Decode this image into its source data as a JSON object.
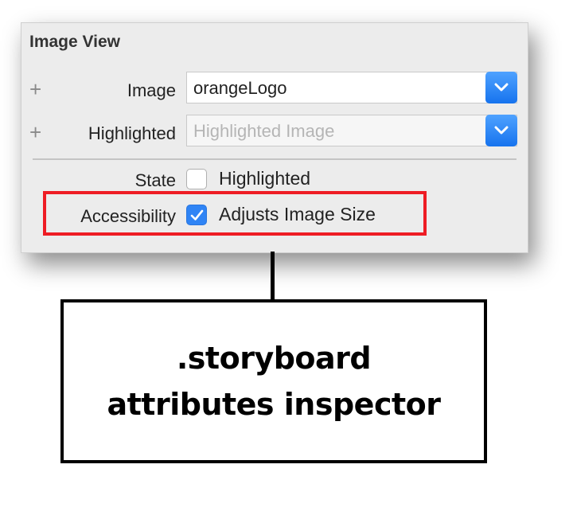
{
  "panel": {
    "title": "Image View",
    "image_row": {
      "plus": "+",
      "label": "Image",
      "value": "orangeLogo"
    },
    "highlighted_row": {
      "plus": "+",
      "label": "Highlighted",
      "placeholder": "Highlighted Image"
    },
    "state_row": {
      "label": "State",
      "checkbox_label": "Highlighted",
      "checked": false
    },
    "accessibility_row": {
      "label": "Accessibility",
      "checkbox_label": "Adjusts Image Size",
      "checked": true
    }
  },
  "callout": {
    "line1": ".storyboard",
    "line2": "attributes inspector"
  },
  "colors": {
    "highlight_box": "#ee1c24",
    "accent_blue": "#2f84f5"
  }
}
